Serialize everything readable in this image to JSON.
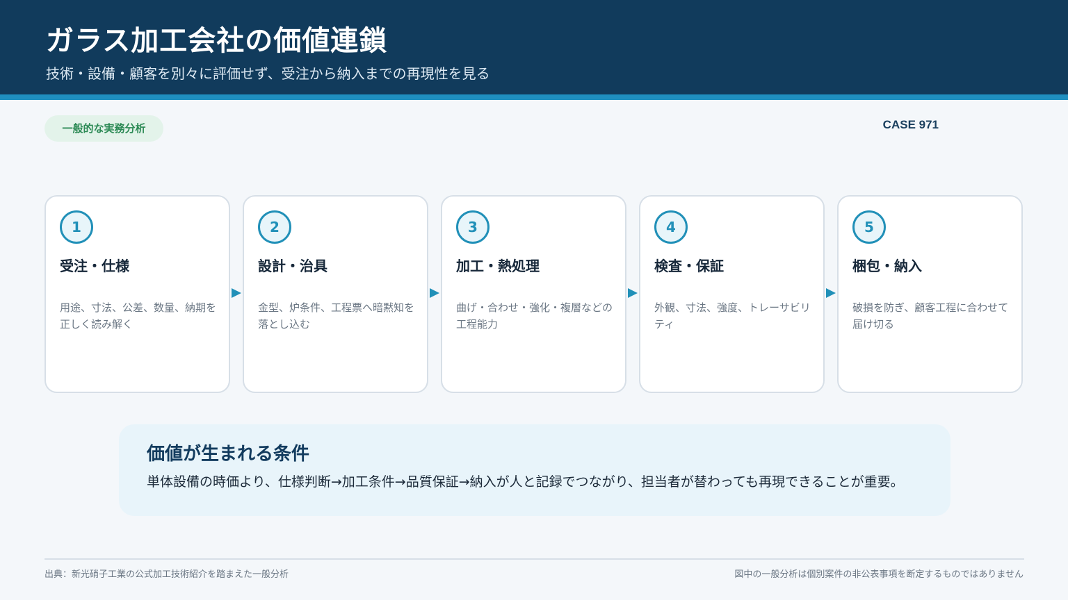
{
  "header": {
    "title": "ガラス加工会社の価値連鎖",
    "subtitle": "技術・設備・顧客を別々に評価せず、受注から納入までの再現性を見る"
  },
  "tag": {
    "label": "一般的な実務分析"
  },
  "case_label": "CASE 971",
  "steps": [
    {
      "num": "1",
      "title": "受注・仕様",
      "desc": "用途、寸法、公差、数量、納期を正しく読み解く"
    },
    {
      "num": "2",
      "title": "設計・治具",
      "desc": "金型、炉条件、工程票へ暗黙知を落とし込む"
    },
    {
      "num": "3",
      "title": "加工・熱処理",
      "desc": "曲げ・合わせ・強化・複層などの工程能力"
    },
    {
      "num": "4",
      "title": "検査・保証",
      "desc": "外観、寸法、強度、トレーサビリティ"
    },
    {
      "num": "5",
      "title": "梱包・納入",
      "desc": "破損を防ぎ、顧客工程に合わせて届け切る"
    }
  ],
  "condition": {
    "title": "価値が生まれる条件",
    "text": "単体設備の時価より、仕様判断→加工条件→品質保証→納入が人と記録でつながり、担当者が替わっても再現できることが重要。"
  },
  "footer": {
    "source": "出典：新光硝子工業の公式加工技術紹介を踏まえた一般分析",
    "disclaimer": "図中の一般分析は個別案件の非公表事項を断定するものではありません"
  },
  "colors": {
    "header_bg": "#113b5c",
    "accent": "#1f8fc0",
    "tag_bg": "#e3f3ea",
    "tag_text": "#2c8a55"
  }
}
